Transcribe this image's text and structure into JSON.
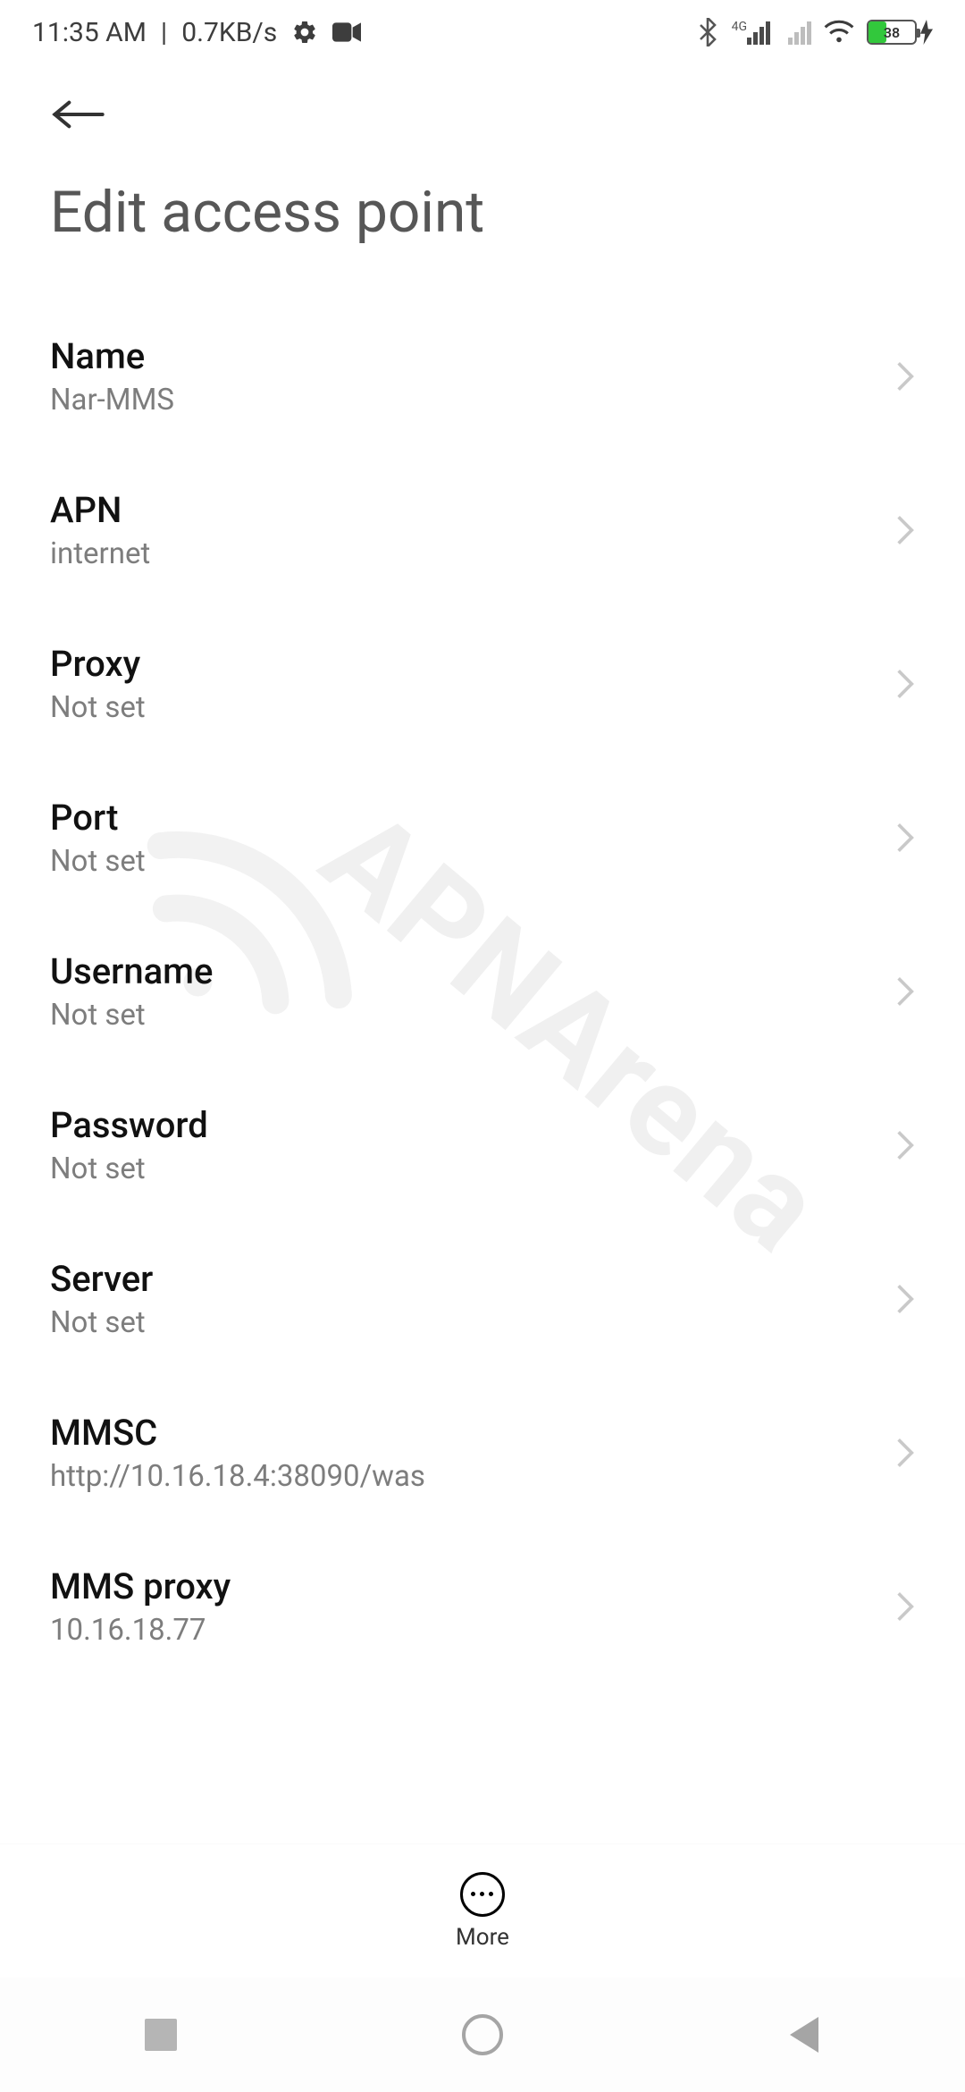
{
  "status": {
    "time": "11:35 AM",
    "speed": "0.7KB/s",
    "network_label": "4G",
    "battery_percent": "38"
  },
  "title": "Edit access point",
  "rows": [
    {
      "label": "Name",
      "value": "Nar-MMS"
    },
    {
      "label": "APN",
      "value": "internet"
    },
    {
      "label": "Proxy",
      "value": "Not set"
    },
    {
      "label": "Port",
      "value": "Not set"
    },
    {
      "label": "Username",
      "value": "Not set"
    },
    {
      "label": "Password",
      "value": "Not set"
    },
    {
      "label": "Server",
      "value": "Not set"
    },
    {
      "label": "MMSC",
      "value": "http://10.16.18.4:38090/was"
    },
    {
      "label": "MMS proxy",
      "value": "10.16.18.77"
    }
  ],
  "bottom": {
    "more": "More"
  },
  "watermark": "APNArena"
}
